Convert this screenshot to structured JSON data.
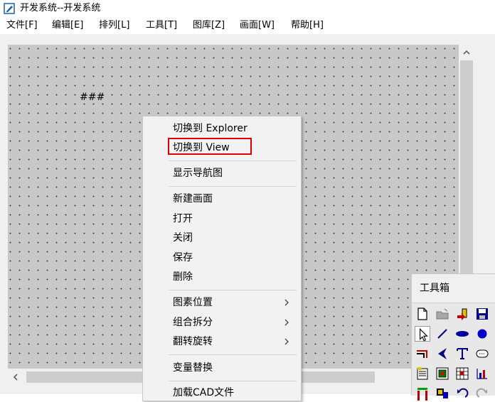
{
  "window": {
    "title": "开发系统--开发系统",
    "icon": "edit-document-icon"
  },
  "menubar": {
    "items": [
      "文件[F]",
      "编辑[E]",
      "排列[L]",
      "工具[T]",
      "图库[Z]",
      "画面[W]",
      "帮助[H]"
    ]
  },
  "canvas": {
    "placeholder_text": "###"
  },
  "context_menu": {
    "items": [
      {
        "label": "切换到 Explorer"
      },
      {
        "label": "切换到 View",
        "highlighted": true
      },
      {
        "label": "显示导航图"
      },
      {
        "label": "新建画面"
      },
      {
        "label": "打开"
      },
      {
        "label": "关闭"
      },
      {
        "label": "保存"
      },
      {
        "label": "删除"
      },
      {
        "label": "图素位置",
        "submenu": true
      },
      {
        "label": "组合拆分",
        "submenu": true
      },
      {
        "label": "翻转旋转",
        "submenu": true
      },
      {
        "label": "变量替换"
      },
      {
        "label": "加载CAD文件"
      }
    ],
    "highlight_color": "#e00000"
  },
  "toolbox": {
    "title": "工具箱",
    "tools": [
      "new-page-icon",
      "open-folder-icon",
      "import-icon",
      "save-disk-icon",
      "pointer-arrow-icon",
      "line-tool-icon",
      "ellipse-flat-icon",
      "circle-fill-icon",
      "polyline-icon",
      "arc-icon",
      "text-tool-icon",
      "rounded-rect-icon",
      "report-icon",
      "image-icon",
      "grid-image-icon",
      "chart-icon",
      "bar-icon",
      "picture-icon",
      "undo-icon",
      "redo-icon"
    ]
  }
}
